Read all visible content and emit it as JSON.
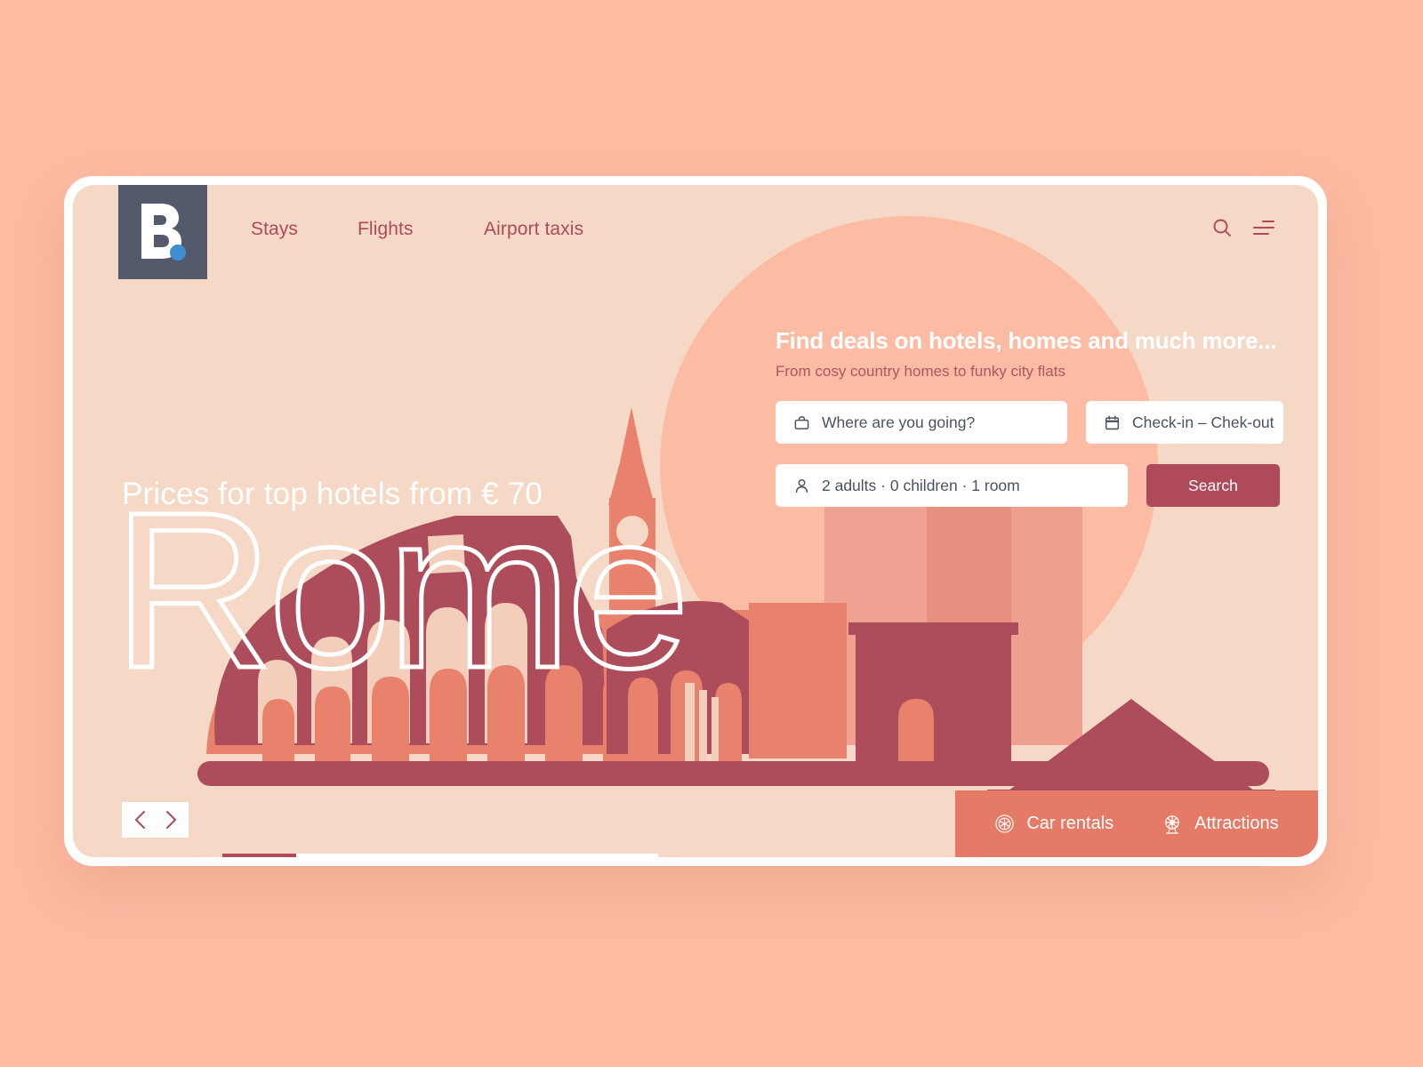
{
  "brand": {
    "logo_letter": "B",
    "logo_name": "booking-logo",
    "logo_bg": "#545a6b",
    "logo_dot_color": "#3f8fd0"
  },
  "colors": {
    "page_background": "#fdbba2",
    "card_background": "#f5d9c6",
    "accent_dark_red": "#ae4a59",
    "accent_salmon": "#e57a66",
    "circle_salmon": "#fcbca4",
    "light_peach": "#f8d5c0",
    "white": "#ffffff",
    "field_text": "#4b5261"
  },
  "header": {
    "nav": [
      {
        "label": "Stays"
      },
      {
        "label": "Flights"
      },
      {
        "label": "Airport taxis"
      }
    ],
    "icons": [
      {
        "name": "search-icon"
      },
      {
        "name": "menu-icon"
      }
    ]
  },
  "hero": {
    "subtitle": "Prices for top hotels from € 70",
    "city": "Rome"
  },
  "search_panel": {
    "title": "Find deals on hotels, homes and much more...",
    "subtitle": "From cosy country homes to funky city flats",
    "destination": {
      "icon": "bag-icon",
      "placeholder": "Where are you going?",
      "value": ""
    },
    "dates": {
      "icon": "calendar-icon",
      "placeholder": "Check-in – Chek-out",
      "value": ""
    },
    "guests": {
      "icon": "person-icon",
      "value": "2 adults · 0 children · 1 room"
    },
    "search_button": "Search"
  },
  "carousel": {
    "prev_label": "‹",
    "next_label": "›",
    "progress_percent": 17
  },
  "action_bar": {
    "items": [
      {
        "label": "Car rentals",
        "icon": "steering-wheel-icon"
      },
      {
        "label": "Attractions",
        "icon": "ferris-wheel-icon"
      }
    ]
  }
}
